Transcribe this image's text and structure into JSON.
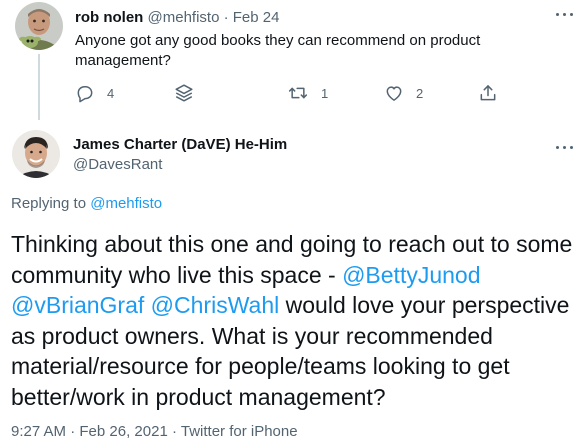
{
  "parent_tweet": {
    "author_name": "rob nolen",
    "author_handle": "@mehfisto",
    "separator": "·",
    "date": "Feb 24",
    "text": "Anyone got any good books they can recommend on product management?",
    "actions": {
      "reply_icon": "reply-icon",
      "reply_count": "4",
      "layers_icon": "layers-icon",
      "retweet_icon": "retweet-icon",
      "retweet_count": "1",
      "like_icon": "heart-icon",
      "like_count": "2",
      "share_icon": "share-icon"
    }
  },
  "main_tweet": {
    "author_name": "James Charter (DaVE) He-Him",
    "author_handle": "@DavesRant",
    "replying_prefix": "Replying to",
    "replying_handle": "@mehfisto",
    "text": {
      "part1": "Thinking about this one and going to reach out to some community who live this space - ",
      "mention1": "@BettyJunod",
      "space1": " ",
      "mention2": "@vBrianGraf",
      "space2": " ",
      "mention3": "@ChrisWahl",
      "part2": " would love your perspective as product owners. What is your recommended material/resource for people/teams looking to get better/work in product management?"
    },
    "time": "9:27 AM",
    "date": "Feb 26, 2021",
    "separator": " · ",
    "source": "Twitter for iPhone"
  },
  "colors": {
    "text": "#0f1419",
    "muted": "#536471",
    "link": "#1d9bf0",
    "thread_line": "#cfd9de"
  }
}
